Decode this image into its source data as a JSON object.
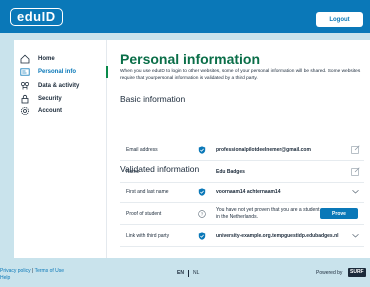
{
  "header": {
    "logo_text": "eduID",
    "logout_label": "Logout"
  },
  "sidebar": {
    "items": [
      {
        "label": "Home",
        "icon": "home-icon"
      },
      {
        "label": "Personal info",
        "icon": "id-card-icon",
        "active": true
      },
      {
        "label": "Data & activity",
        "icon": "data-activity-icon"
      },
      {
        "label": "Security",
        "icon": "lock-icon"
      },
      {
        "label": "Account",
        "icon": "gear-icon"
      }
    ]
  },
  "main": {
    "title": "Personal information",
    "intro": "When you use eduID to login to other websites, some of your personal information will be shared. Some websites require that yourpersonal information is validated by a third party.",
    "basic": {
      "title": "Basic information",
      "rows": [
        {
          "label": "Email address",
          "value": "professionalpilotdeelnemer@gmail.com"
        },
        {
          "label": "Name",
          "value": "Edu Badges"
        }
      ]
    },
    "validated": {
      "title": "Validated information",
      "rows": [
        {
          "label": "First and last name",
          "value": "voornaam14 achternaam14"
        },
        {
          "label": "Proof of student",
          "value": "You have not yet proven that you are a student in the Netherlands.",
          "button": "Prove"
        },
        {
          "label": "Link with third party",
          "value": "university-example.org.tempguestidp.edubadges.nl"
        }
      ]
    }
  },
  "footer": {
    "privacy": "Privacy policy",
    "separator": "|",
    "terms": "Terms of Use",
    "help": "Help",
    "lang_en": "EN",
    "lang_nl": "NL",
    "powered_by": "Powered by",
    "surf": "SURF"
  },
  "colors": {
    "header_bg": "#0a78b8",
    "page_bg": "#c9e3ec",
    "title_green": "#0a6e48",
    "accent_blue": "#0a78b8"
  }
}
